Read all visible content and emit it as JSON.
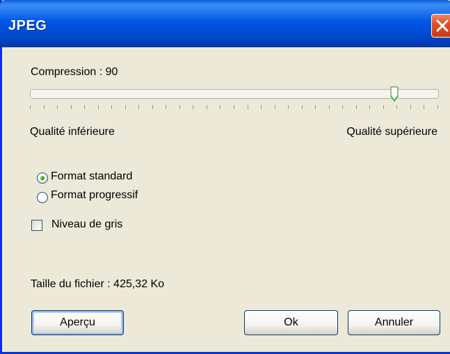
{
  "window": {
    "title": "JPEG"
  },
  "compression": {
    "label": "Compression : 90",
    "value": 90,
    "min": 0,
    "max": 100,
    "tick_count": 30
  },
  "quality": {
    "low_label": "Qualité inférieure",
    "high_label": "Qualité supérieure"
  },
  "format": {
    "options": [
      {
        "label": "Format standard",
        "selected": true
      },
      {
        "label": "Format progressif",
        "selected": false
      }
    ]
  },
  "grayscale": {
    "label": "Niveau de gris",
    "checked": false
  },
  "file_size": {
    "label": "Taille du fichier : 425,32 Ko"
  },
  "buttons": {
    "preview": "Aperçu",
    "ok": "Ok",
    "cancel": "Annuler"
  },
  "colors": {
    "titlebar": "#0058e6",
    "dialog_bg": "#ece9d8",
    "close_button": "#e0502a",
    "radio_dot": "#2d9a1e"
  },
  "icons": {
    "close": "close-icon"
  }
}
